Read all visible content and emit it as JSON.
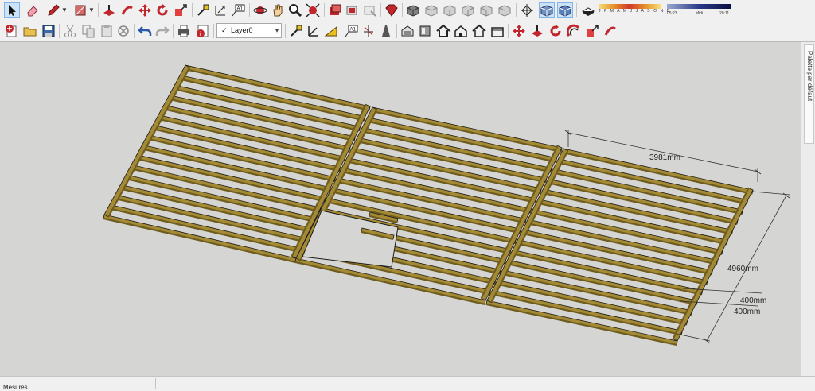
{
  "toolbar": {
    "row1_tools": [
      "select-icon",
      "eraser-icon",
      "pencil-icon",
      "rectangle-icon",
      "push-pull-icon",
      "follow-me-icon",
      "move-icon",
      "rotate-icon",
      "scale-icon",
      "tape-measure-icon",
      "dimension-icon",
      "text-icon",
      "orbit-icon",
      "pan-icon",
      "zoom-icon",
      "zoom-extents-icon",
      "component-icon",
      "paint-bucket-icon",
      "section-icon",
      "ruby-icon",
      "iso-view-icon",
      "top-view-icon",
      "front-view-icon",
      "right-view-icon",
      "back-view-icon",
      "left-view-icon",
      "camera-position-icon",
      "xray-style-icon",
      "wireframe-style-icon",
      "shadow-toggle-icon"
    ],
    "row2_tools": [
      "new-model-icon",
      "open-icon",
      "save-icon",
      "cut-icon",
      "copy-icon",
      "delete-icon",
      "undo-icon",
      "redo-icon",
      "print-icon",
      "model-info-icon",
      "tag-tool-icon",
      "axes-icon",
      "protractor-icon",
      "line-icon",
      "sandbox-icon",
      "warehouse-icon",
      "extension-icon",
      "house-icon",
      "house-outline-icon",
      "house-2-icon",
      "house-3-icon",
      "move-2-icon",
      "push-pull-2-icon",
      "rotate-2-icon",
      "offset-icon",
      "scale-2-icon",
      "follow-me-2-icon"
    ],
    "layer": {
      "check": "✓",
      "name": "Layer0",
      "arrow": "▾"
    }
  },
  "shadows": {
    "months": "J F M A M J J A S O N D",
    "time_start": "05:23",
    "time_mid": "Midi",
    "time_end": "20:11"
  },
  "tray": {
    "label": "Palette par défaut"
  },
  "dimensions": {
    "width": "3981mm",
    "length": "4960mm",
    "spacing_1": "400mm",
    "spacing_2": "400mm"
  },
  "status": {
    "measure_label": "Mesures"
  },
  "colors": {
    "wood": "#a48a34",
    "wood_shadow": "#6e5d1f",
    "background": "#d5d5d3",
    "accent": "#c0262c"
  }
}
